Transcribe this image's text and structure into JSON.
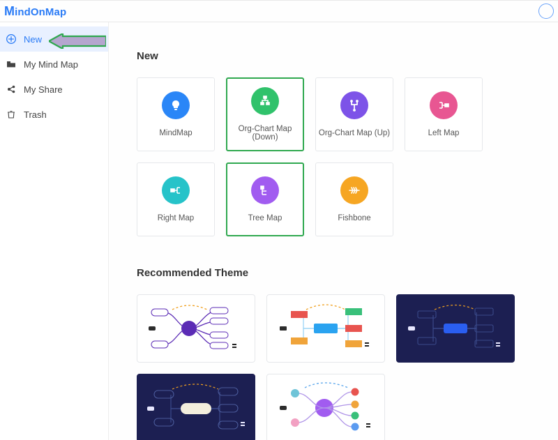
{
  "logo": "MindOnMap",
  "sidebar": {
    "items": [
      {
        "label": "New",
        "icon": "plus-circle-icon"
      },
      {
        "label": "My Mind Map",
        "icon": "folder-icon"
      },
      {
        "label": "My Share",
        "icon": "share-icon"
      },
      {
        "label": "Trash",
        "icon": "trash-icon"
      }
    ]
  },
  "sections": {
    "new_h": "New",
    "recommended_h": "Recommended Theme"
  },
  "templates": [
    {
      "label": "MindMap",
      "color": "c-blue",
      "icon": "bulb-icon",
      "selected": false
    },
    {
      "label": "Org-Chart Map (Down)",
      "color": "c-green",
      "icon": "hier-icon",
      "selected": true
    },
    {
      "label": "Org-Chart Map (Up)",
      "color": "c-purple",
      "icon": "fork-icon",
      "selected": false
    },
    {
      "label": "Left Map",
      "color": "c-pink",
      "icon": "left-icon",
      "selected": false
    },
    {
      "label": "Right Map",
      "color": "c-cyan",
      "icon": "right-icon",
      "selected": false
    },
    {
      "label": "Tree Map",
      "color": "c-violet",
      "icon": "tree-icon",
      "selected": true
    },
    {
      "label": "Fishbone",
      "color": "c-orange",
      "icon": "fish-icon",
      "selected": false
    }
  ],
  "themes": [
    {
      "name": "theme-purple-radial",
      "variant": "light"
    },
    {
      "name": "theme-color-blocks",
      "variant": "light"
    },
    {
      "name": "theme-dark-navy",
      "variant": "dark"
    },
    {
      "name": "theme-dark-capsule",
      "variant": "dark"
    },
    {
      "name": "theme-violet-radial",
      "variant": "light"
    }
  ]
}
